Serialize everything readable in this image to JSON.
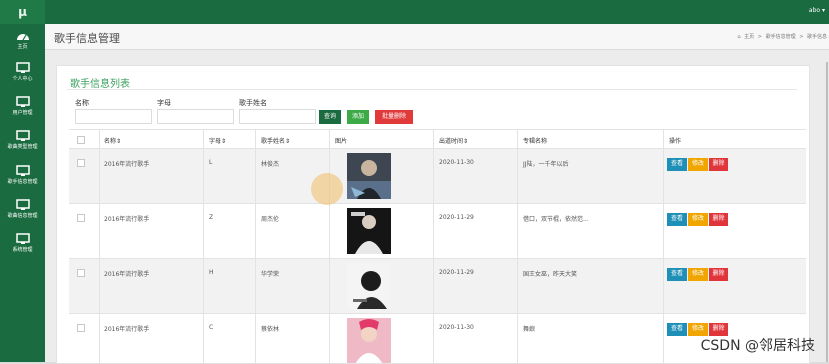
{
  "app": {
    "logo_text": "μ",
    "user_name": "abo ▾"
  },
  "sidebar": {
    "items": [
      {
        "label": "主页",
        "icon": "dashboard-icon"
      },
      {
        "label": "个人中心",
        "icon": "monitor-icon"
      },
      {
        "label": "用户管理",
        "icon": "monitor-icon"
      },
      {
        "label": "歌曲类型管理",
        "icon": "monitor-icon"
      },
      {
        "label": "歌手信息管理",
        "icon": "monitor-icon"
      },
      {
        "label": "歌曲信息管理",
        "icon": "monitor-icon"
      },
      {
        "label": "系统管理",
        "icon": "monitor-icon"
      }
    ]
  },
  "header": {
    "title": "歌手信息管理",
    "breadcrumb": [
      "主页",
      ">",
      "歌手信息管理",
      ">",
      "歌手信息"
    ]
  },
  "card": {
    "title": "歌手信息列表"
  },
  "filters": {
    "name_label": "名称",
    "letter_label": "字母",
    "singer_label": "歌手姓名",
    "name_value": "",
    "letter_value": "",
    "singer_value": ""
  },
  "buttons": {
    "query": "查询",
    "add": "添加",
    "batch_delete": "批量删除"
  },
  "table": {
    "columns": [
      "名称⇕",
      "字母⇕",
      "歌手姓名⇕",
      "图片",
      "出道时间⇕",
      "专辑名称",
      "操作"
    ],
    "rows": [
      {
        "name": "2016年流行歌手",
        "letter": "L",
        "singer": "林俊杰",
        "debut": "2020-11-30",
        "album": "JJ陆，一千年以后"
      },
      {
        "name": "2016年流行歌手",
        "letter": "Z",
        "singer": "周杰伦",
        "debut": "2020-11-29",
        "album": "借口，双节棍，依然范..."
      },
      {
        "name": "2016年流行歌手",
        "letter": "H",
        "singer": "华学荣",
        "debut": "2020-11-29",
        "album": "国王女巫，昨天大笑"
      },
      {
        "name": "2016年流行歌手",
        "letter": "C",
        "singer": "蔡依林",
        "debut": "2020-11-30",
        "album": "舞娘"
      }
    ],
    "actions": {
      "view": "查看",
      "edit": "修改",
      "delete": "删除"
    }
  },
  "watermark": "CSDN @邻居科技",
  "colors": {
    "primary": "#1a6b3f",
    "accent": "#3aa05f",
    "view": "#1e8fb6",
    "edit": "#f0a500",
    "delete": "#e0353b"
  }
}
